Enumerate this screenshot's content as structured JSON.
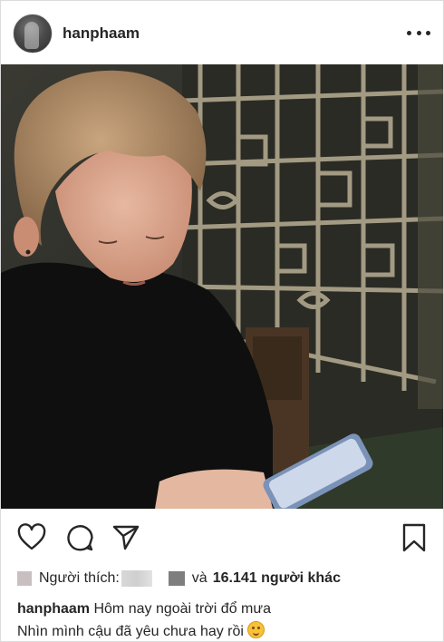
{
  "post": {
    "username": "hanphaam",
    "more_icon": "ellipsis-icon",
    "image_alt": "Post photo",
    "actions": {
      "like_icon": "heart-icon",
      "comment_icon": "comment-icon",
      "share_icon": "send-icon",
      "save_icon": "bookmark-icon"
    },
    "likes": {
      "liked_by_label": "Người thích:",
      "and_label": "và",
      "others_count": "16.141",
      "others_label": "người khác"
    },
    "caption": {
      "username": "hanphaam",
      "line1": "Hôm nay ngoài trời đổ mưa",
      "line2": "Nhìn mình cậu đã yêu chưa hay rồi"
    }
  }
}
